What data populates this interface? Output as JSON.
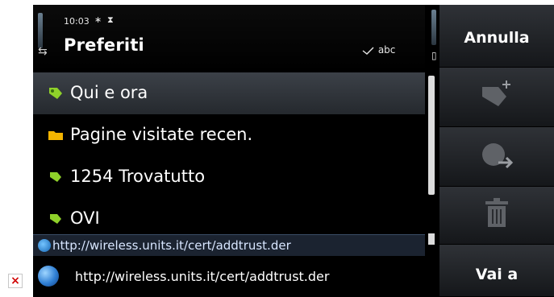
{
  "status": {
    "time": "10:03",
    "bluetooth_glyph": "∗",
    "hourglass_glyph": "⧗",
    "title": "Preferiti",
    "input_mode": "abc",
    "input_mode_icon": "pen-icon"
  },
  "list": {
    "items": [
      {
        "label": "Qui e ora",
        "icon": "location-bookmark-icon",
        "selected": true
      },
      {
        "label": "Pagine visitate recen.",
        "icon": "folder-icon",
        "selected": false
      },
      {
        "label": "1254 Trovatutto",
        "icon": "bookmark-icon",
        "selected": false
      },
      {
        "label": "OVI",
        "icon": "bookmark-icon",
        "selected": false
      }
    ]
  },
  "tooltip": {
    "url": "http://wireless.units.it/cert/addtrust.der"
  },
  "address_bar": {
    "url": "http://wireless.units.it/cert/addtrust.der"
  },
  "toolbar": {
    "cancel_label": "Annulla",
    "add_bookmark_icon": "add-bookmark-icon",
    "go_web_icon": "globe-arrow-icon",
    "delete_icon": "trash-icon",
    "go_label": "Vai a"
  },
  "colors": {
    "background": "#000000",
    "selection": "#3c4148",
    "text": "#ffffff",
    "folder": "#f3b400",
    "bookmark": "#8fd12a"
  }
}
